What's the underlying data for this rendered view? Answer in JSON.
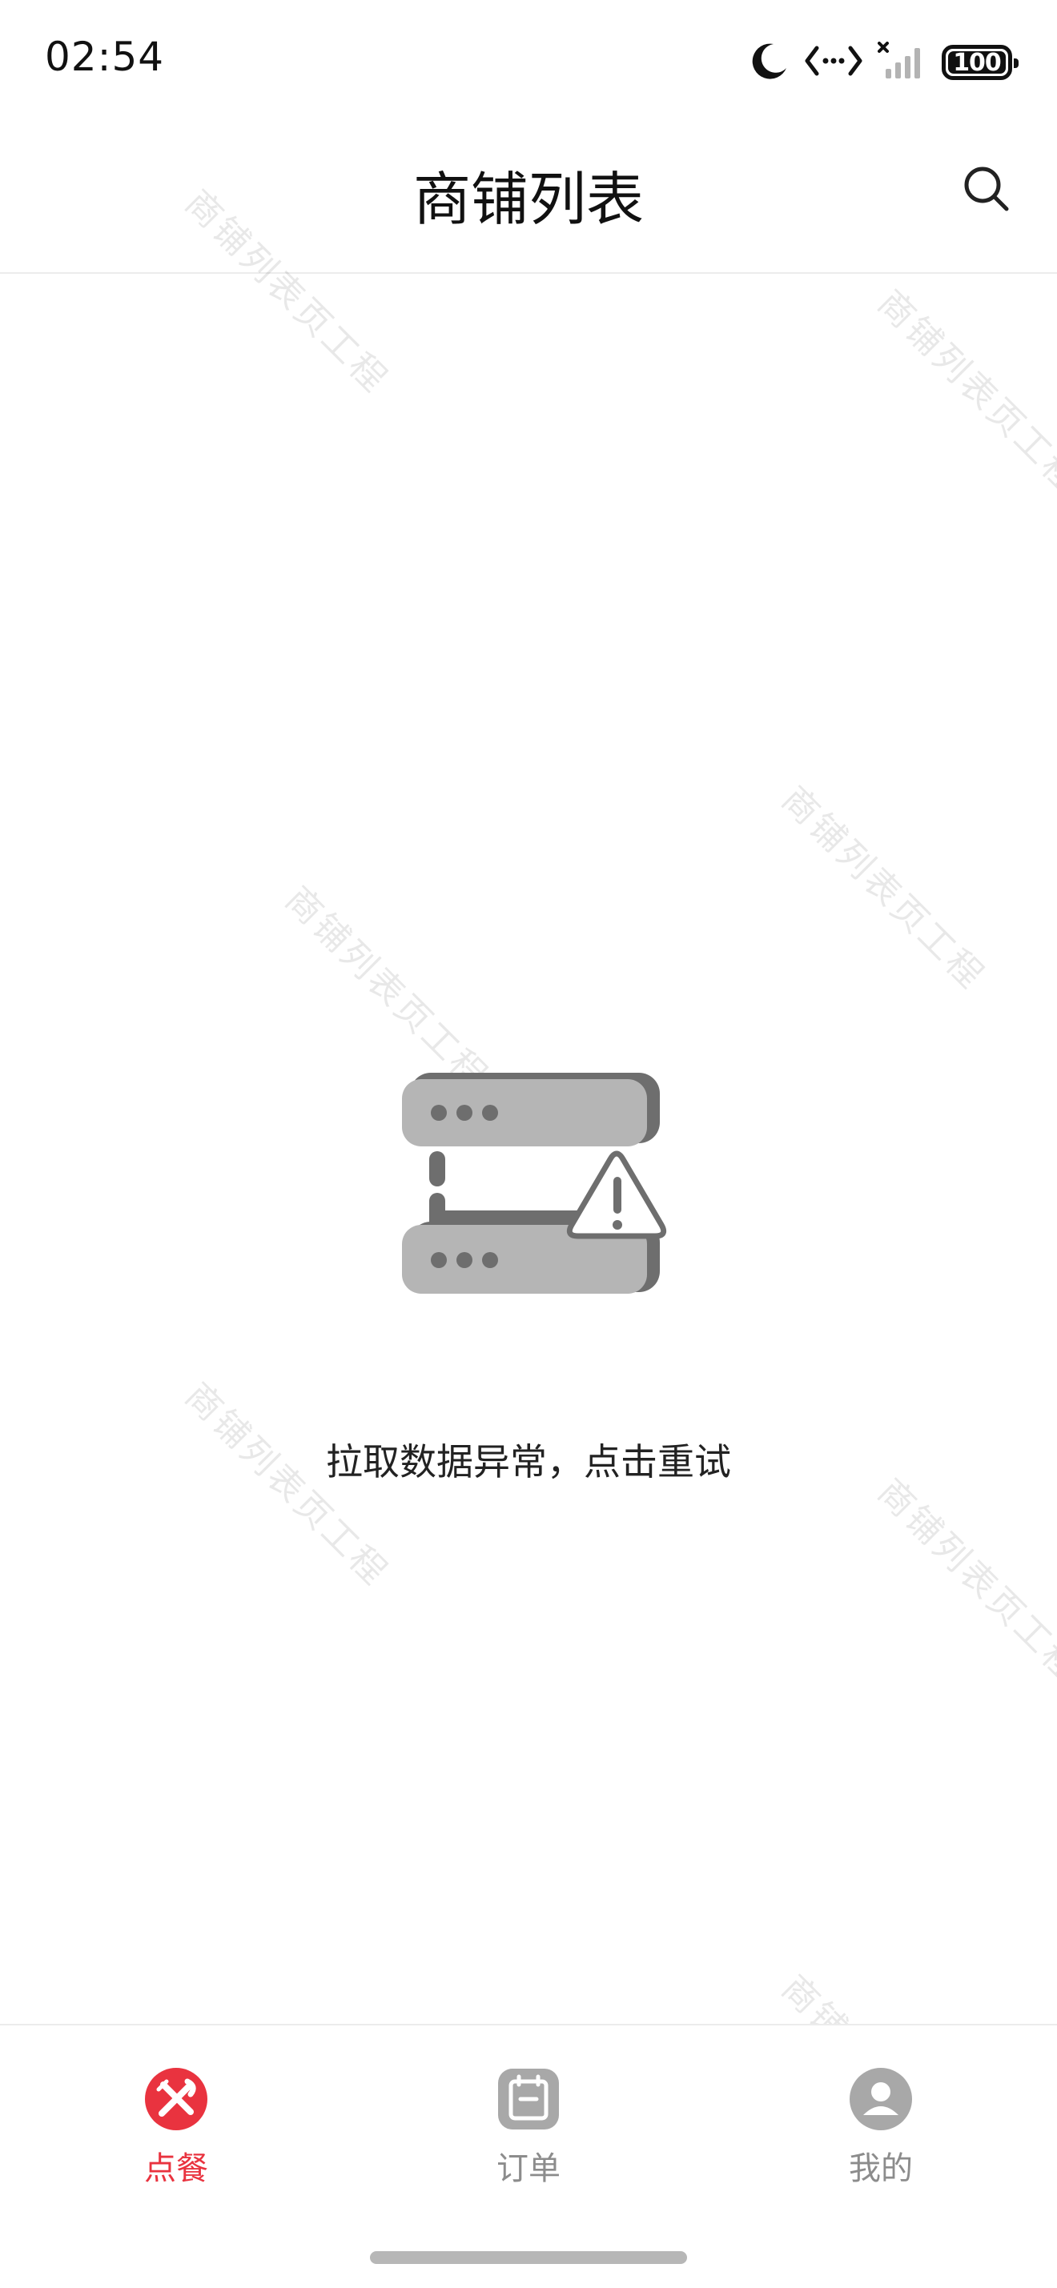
{
  "status_bar": {
    "time": "02:54",
    "battery": "100",
    "icons": [
      "moon-icon",
      "data-transfer-icon",
      "signal-no-service-icon",
      "battery-icon"
    ]
  },
  "header": {
    "title": "商铺列表",
    "search_icon": "search-icon"
  },
  "watermark": {
    "text": "商铺列表页工程"
  },
  "error_state": {
    "message": "拉取数据异常，点击重试",
    "icon": "server-warning-icon"
  },
  "tabs": [
    {
      "label": "点餐",
      "icon": "fork-knife-icon",
      "active": true
    },
    {
      "label": "订单",
      "icon": "calendar-icon",
      "active": false
    },
    {
      "label": "我的",
      "icon": "user-icon",
      "active": false
    }
  ],
  "colors": {
    "accent": "#e9333f",
    "inactive": "#8c8c8c",
    "illustration_gray": "#b5b5b5",
    "illustration_dark": "#6e6e6e"
  }
}
